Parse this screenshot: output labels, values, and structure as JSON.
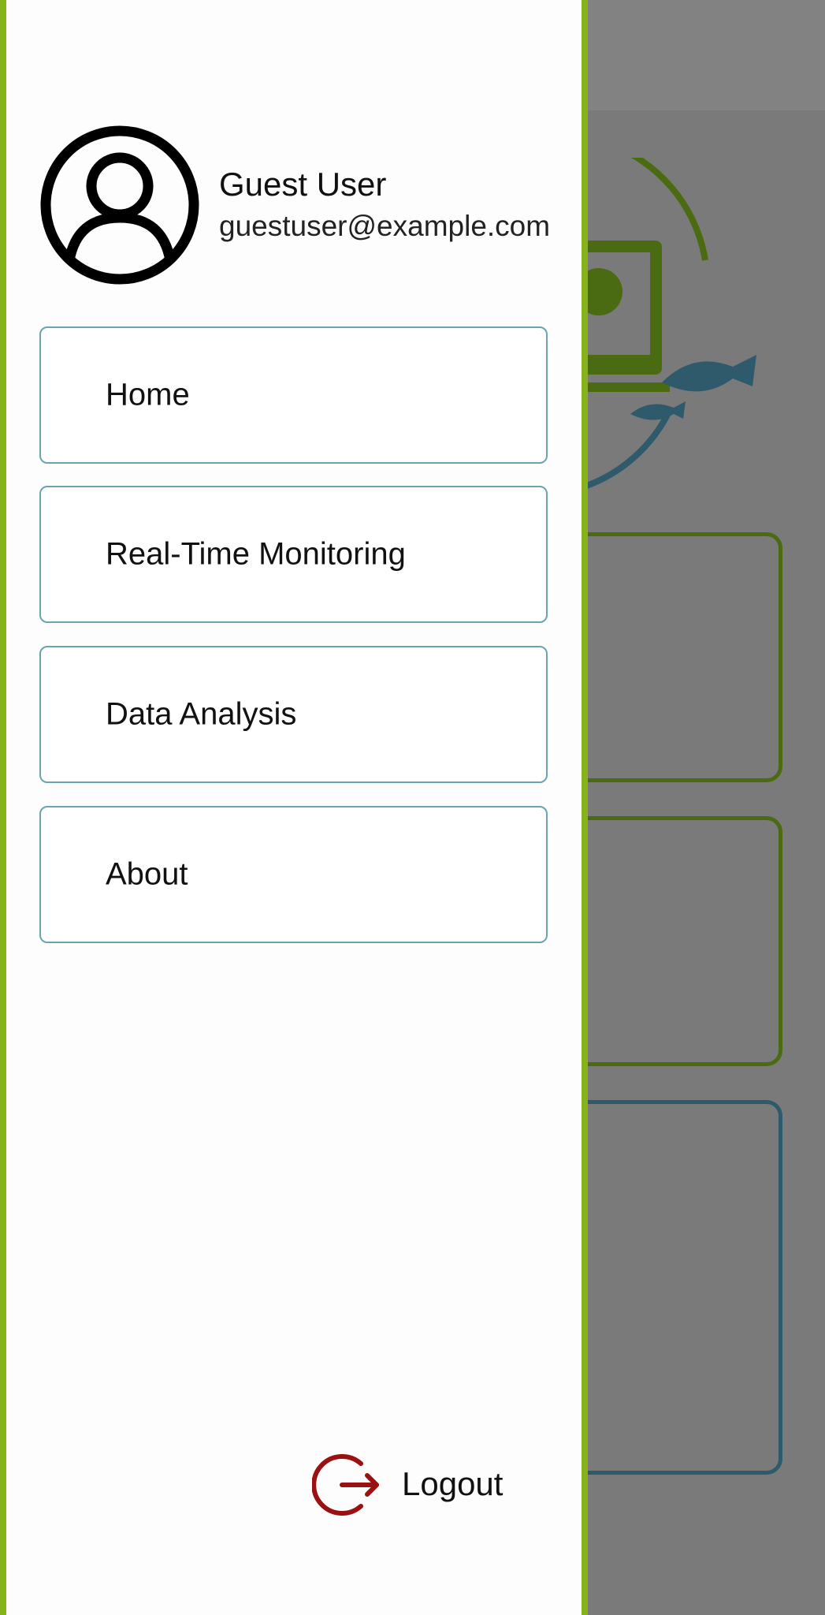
{
  "drawer": {
    "user": {
      "name": "Guest User",
      "email": "guestuser@example.com",
      "avatar_icon": "account-circle-icon"
    },
    "menu": [
      {
        "label": "Home"
      },
      {
        "label": "Real-Time Monitoring"
      },
      {
        "label": "Data Analysis"
      },
      {
        "label": "About"
      }
    ],
    "logout": {
      "label": "Logout",
      "icon": "logout-icon"
    }
  },
  "colors": {
    "drawer_border": "#88b21c",
    "menu_border": "#6aa3b2",
    "logout_icon": "#9b1111",
    "brand_green": "#4a6b12",
    "brand_teal": "#2f5a6b"
  }
}
